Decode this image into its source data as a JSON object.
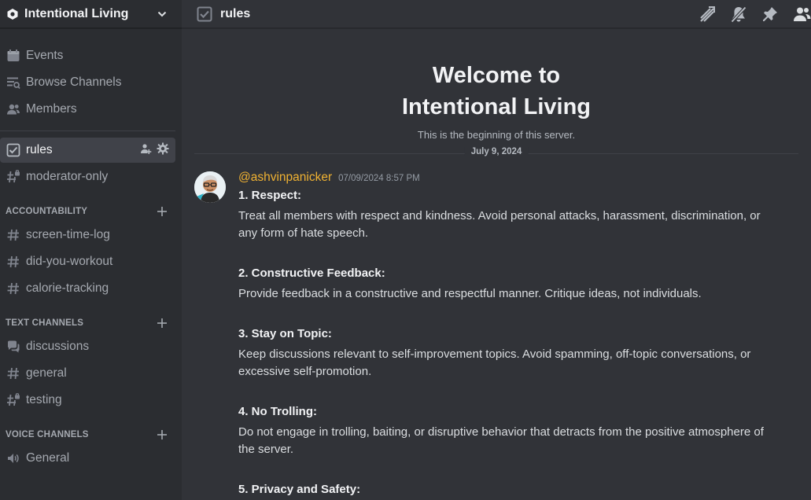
{
  "server": {
    "name": "Intentional Living"
  },
  "nav": [
    {
      "label": "Events",
      "icon": "calendar-icon"
    },
    {
      "label": "Browse Channels",
      "icon": "browse-channels-icon"
    },
    {
      "label": "Members",
      "icon": "members-icon"
    }
  ],
  "channels_top": [
    {
      "label": "rules",
      "icon": "rules-icon",
      "selected": true
    },
    {
      "label": "moderator-only",
      "icon": "locked-hash-icon"
    }
  ],
  "categories": [
    {
      "label": "ACCOUNTABILITY",
      "channels": [
        "screen-time-log",
        "did-you-workout",
        "calorie-tracking"
      ]
    },
    {
      "label": "TEXT CHANNELS",
      "channels": [
        "discussions",
        "general",
        "testing"
      ]
    },
    {
      "label": "VOICE CHANNELS",
      "channels": [
        "General"
      ]
    }
  ],
  "topbar": {
    "channel": "rules"
  },
  "welcome": {
    "line1": "Welcome to",
    "line2": "Intentional Living",
    "subtitle": "This is the beginning of this server."
  },
  "date_divider": "July 9, 2024",
  "message": {
    "author": "@ashvinpanicker",
    "timestamp": "07/09/2024 8:57 PM",
    "rules": [
      {
        "title": "1. Respect:",
        "text": " Treat all members with respect and kindness. Avoid personal attacks, harassment, discrimination, or any form of hate speech."
      },
      {
        "title": "2. Constructive Feedback:",
        "text": " Provide feedback in a constructive and respectful manner. Critique ideas, not individuals."
      },
      {
        "title": "3. Stay on Topic:",
        "text": "Keep discussions relevant to self-improvement topics. Avoid spamming, off-topic conversations, or excessive self-promotion."
      },
      {
        "title": "4. No Trolling:",
        "text": " Do not engage in trolling, baiting, or disruptive behavior that detracts from the positive atmosphere of the server."
      },
      {
        "title": "5. Privacy and Safety:",
        "text": ""
      }
    ]
  },
  "colors": {
    "accent_author": "#f0b232",
    "sidebar_bg": "#2b2d31",
    "main_bg": "#313338",
    "selected_bg": "#404249"
  }
}
